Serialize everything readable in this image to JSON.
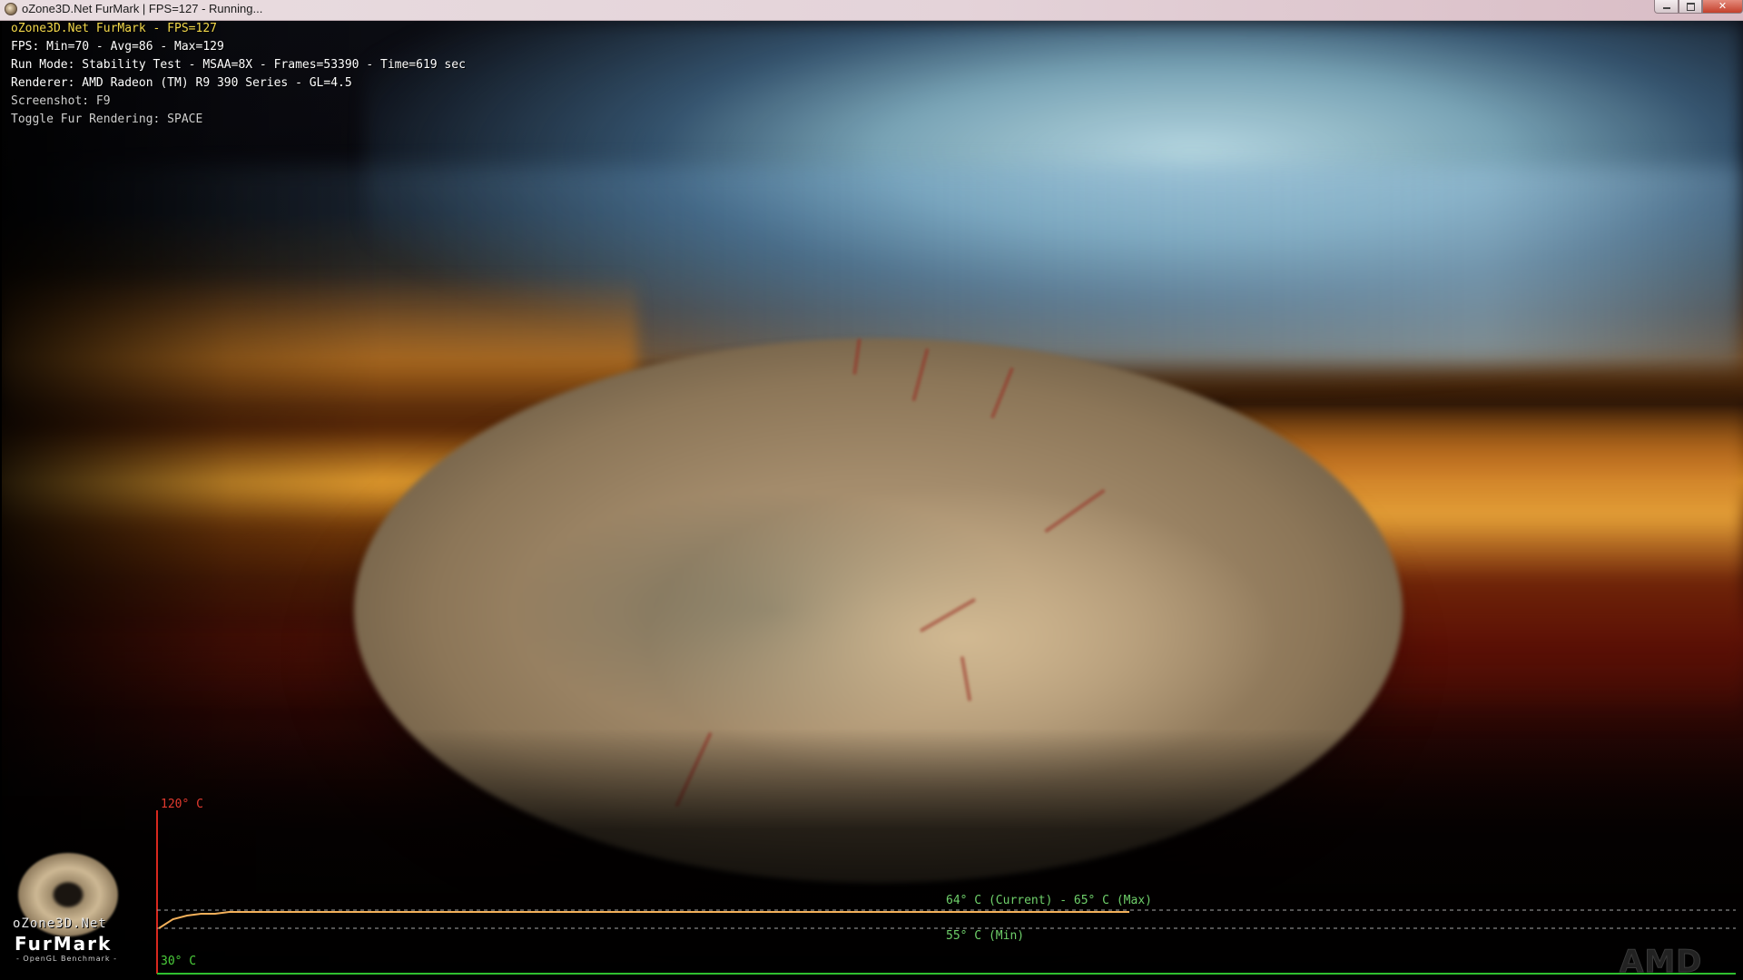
{
  "window": {
    "title": "oZone3D.Net FurMark | FPS=127 - Running...",
    "minimize_label": "",
    "maximize_label": "",
    "close_label": "✕"
  },
  "hud": {
    "title": "oZone3D.Net FurMark - FPS=127",
    "fps": "FPS: Min=70 - Avg=86 - Max=129",
    "run_mode": "Run Mode: Stability Test - MSAA=8X - Frames=53390 - Time=619 sec",
    "renderer": "Renderer: AMD Radeon (TM) R9 390 Series - GL=4.5",
    "screenshot": "Screenshot: F9",
    "toggle": "Toggle Fur Rendering: SPACE"
  },
  "graph": {
    "max_scale_label": "120° C",
    "min_scale_label": "30° C",
    "current_label": "64° C (Current) - 65° C (Max)",
    "min_label": "55° C (Min)",
    "scale_min": 30,
    "scale_max": 120,
    "current_temp": 64,
    "max_temp": 65,
    "min_temp": 55,
    "series": [
      55,
      60,
      62,
      63,
      63,
      64,
      64,
      64,
      64,
      64,
      64,
      64,
      64,
      64,
      64,
      64,
      64,
      64,
      64,
      64,
      64,
      64,
      64,
      64,
      64,
      64,
      64,
      64,
      64,
      64,
      64,
      64,
      64,
      64,
      64,
      64,
      64,
      64,
      64,
      64,
      64,
      64,
      64,
      64,
      64,
      64,
      64,
      64,
      64,
      64,
      64,
      64,
      64,
      64,
      64,
      64,
      64,
      64,
      64,
      64,
      64,
      64,
      64,
      64,
      64,
      64,
      64,
      64,
      64,
      64
    ],
    "colors": {
      "axis": "#d8281e",
      "baseline": "#2fbf2f",
      "line": "#f3b05a",
      "guides": "#a8a8a8",
      "current_text": "#6fd06a"
    }
  },
  "logo": {
    "brand": "oZone3D.Net",
    "product": "FurMark",
    "subtitle": "- OpenGL Benchmark -"
  },
  "vendor_logo": "AMD"
}
